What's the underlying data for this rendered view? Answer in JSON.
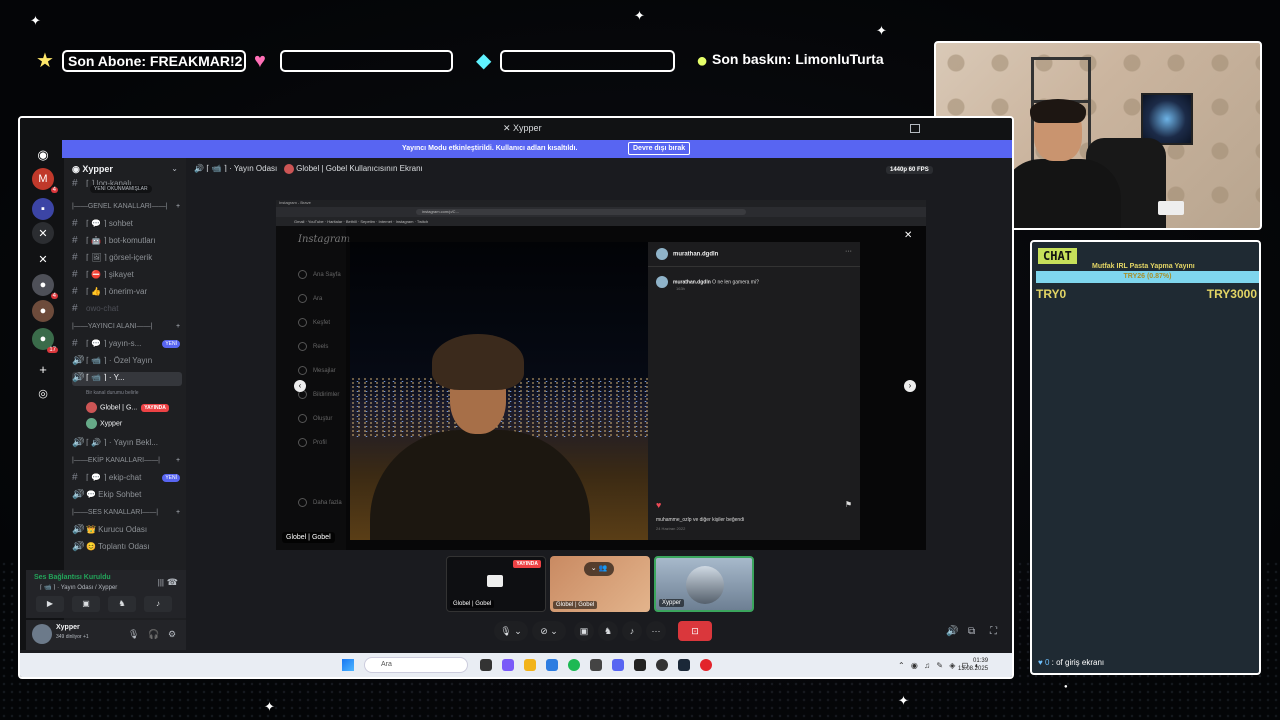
{
  "overlay": {
    "last_sub": "Son Abone: FREAKMAR!2",
    "box2": "",
    "box3": "",
    "last_raid": "Son baskın: LimonluTurta"
  },
  "chat": {
    "title": "CHAT",
    "goal_title": "Mutfak IRL Pasta Yapma Yayını",
    "goal_progress": "TRY26 (0.87%)",
    "goal_fraction": 0.0087,
    "goal_min": "TRY0",
    "goal_max": "TRY3000",
    "message": {
      "user": "",
      "badges": "♥ 0",
      "text": ": of giriş ekranı"
    }
  },
  "discord": {
    "window_title": "Xypper",
    "banner_text": "Yayıncı Modu etkinleştirildi. Kullanıcı adları kısaltıldı.",
    "banner_button": "Devre dışı bırak",
    "server_name": "Xypper",
    "unread_tip": "YENİ OKUNMAMIŞLAR",
    "channels": [
      {
        "type": "cat",
        "label": "|——GENEL KANALLARI——|"
      },
      {
        "type": "text",
        "icon": "#",
        "label": "⌈ 💬 ⌉ sohbet"
      },
      {
        "type": "text",
        "icon": "#",
        "label": "⌈ 🤖 ⌉ bot-komutları"
      },
      {
        "type": "text",
        "icon": "#",
        "label": "⌈ 🖼 ⌉ görsel-içerik"
      },
      {
        "type": "text",
        "icon": "#",
        "label": "⌈ ⛔ ⌉ şikayet"
      },
      {
        "type": "text",
        "icon": "#",
        "label": "⌈ 👍 ⌉ önerim-var"
      },
      {
        "type": "text",
        "icon": "#",
        "label": "owo-chat",
        "dim": true
      },
      {
        "type": "cat",
        "label": "|——YAYINCI ALANI——|"
      },
      {
        "type": "text",
        "icon": "#",
        "label": "⌈ 💬 ⌉ yayın-s...",
        "tag": "YENİ"
      },
      {
        "type": "voice",
        "icon": "🔊",
        "label": "⌈ 📹 ⌉ · Özel Yayın"
      },
      {
        "type": "voice",
        "icon": "🔊",
        "label": "⌈ 📹 ⌉ · Y...",
        "active": true
      }
    ],
    "channel_status": "Bir kanal durumu belirle",
    "voice_users": [
      {
        "name": "Globel | G...",
        "live": "YAYINDA"
      },
      {
        "name": "Xypper"
      }
    ],
    "channels2": [
      {
        "type": "voice",
        "icon": "🔊",
        "label": "⌈ 🔊 ⌉ · Yayın Bekl..."
      },
      {
        "type": "cat",
        "label": "|——EKİP KANALLARI——|"
      },
      {
        "type": "text",
        "icon": "#",
        "label": "⌈ 💬 ⌉ ekip-chat",
        "tag": "YENİ"
      },
      {
        "type": "voice",
        "icon": "🔊",
        "label": "💬 Ekip Sohbet"
      },
      {
        "type": "cat",
        "label": "|——SES KANALLARI——|"
      },
      {
        "type": "voice",
        "icon": "🔊",
        "label": "👑 Kurucu Odası"
      },
      {
        "type": "voice",
        "icon": "🔊",
        "label": "😊 Toplantı Odası"
      }
    ],
    "voice_status": "Ses Bağlantısı Kuruldu",
    "voice_channel": "⌈ 📹 ⌉ · Yayın Odası / Xypper",
    "user_name": "Xypper",
    "user_status": "349 dinliyor +1",
    "stream_channel": "⌈ 📹 ⌉ · Yayın Odası",
    "stream_title": "Globel | Gobel Kullanıcısının Ekranı",
    "quality": "1440p 60 FPS",
    "stream_label": "Globel | Gobel",
    "tiles": [
      {
        "label": "Globel | Gobel",
        "live": "YAYINDA"
      },
      {
        "label": "Globel | Gobel"
      },
      {
        "label": "Xypper"
      }
    ]
  },
  "instagram": {
    "browser_title": "Instagram - Brave",
    "url": "instagram.com/p/C...",
    "logo": "Instagram",
    "nav": [
      "Ana Sayfa",
      "Ara",
      "Keşfet",
      "Reels",
      "Mesajlar",
      "Bildirimler",
      "Oluştur",
      "Profil",
      "Daha fazla"
    ],
    "post_user": "murathan.dgdln",
    "comment_user": "murathan.dgdln",
    "comment": "O ne len gamera mi?",
    "comment_age": "163h",
    "likes": "muhamme_ozlp ve diğer kişiler beğendi",
    "date": "24 Haziran 2022"
  },
  "taskbar": {
    "search": "Ara",
    "time": "01:39",
    "date": "13.08.2025"
  }
}
